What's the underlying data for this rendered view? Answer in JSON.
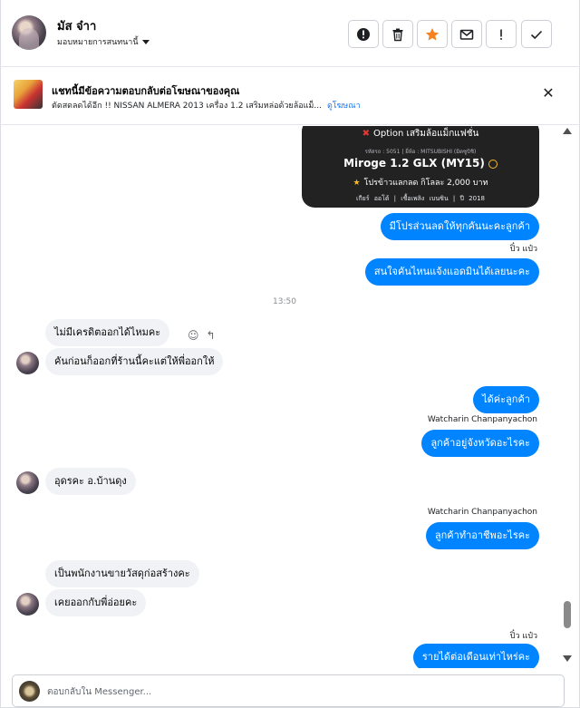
{
  "header": {
    "contact_name": "มัส จ๋าา",
    "assign_label": "มอบหมายการสนทนานี้",
    "tools": [
      {
        "name": "mark-spam",
        "icon": "alert-circle-icon"
      },
      {
        "name": "delete",
        "icon": "trash-icon"
      },
      {
        "name": "star",
        "icon": "star-icon"
      },
      {
        "name": "mark-unread",
        "icon": "envelope-icon"
      },
      {
        "name": "follow-up",
        "icon": "exclamation-icon"
      },
      {
        "name": "done",
        "icon": "check-icon"
      }
    ],
    "accent_star": "#f5821f"
  },
  "ad_banner": {
    "title": "แชทนี้มีข้อความตอบกลับต่อโฆษณาของคุณ",
    "subtitle": "ตัดสดลดได้อีก !! NISSAN ALMERA 2013 เครื่อง 1.2 เสริมหล่อด้วยล้อแม็...",
    "link": "ดูโฆษณา",
    "close_icon": "close-icon"
  },
  "car_card": {
    "option": "Option เสริมล้อแม็กแฟชั่น",
    "meta": "รหัสรถ : 5051 | ยี่ห้อ : MITSUBISHI (มิตซูบิชิ)",
    "model": "Miroge 1.2 GLX (MY15)",
    "promo": "โปรข้าวแลกลด กิโลละ 2,000 บาท",
    "specs": "เกียร์ ออโต้ | เชื้อเพลิง เบนซิน | ปี 2018"
  },
  "messages": {
    "m1": "มีโปรส่วนลดให้ทุกคันนะคะลูกค้า",
    "s1": "ปิ๋ว แป๋ว",
    "m2": "สนใจคันไหนแจ้งแอดมินได้เลยนะคะ",
    "time": "13:50",
    "m3": "ไม่มีเครดิตออกได้ไหมคะ",
    "m4": "คันก่อนก็ออกที่ร้านนี้คะแต่ให้พี่ออกให้",
    "m5": "ได้ค่ะลูกค้า",
    "s2": "Watcharin Chanpanyachon",
    "m6": "ลูกค้าอยู่จังหวัดอะไรคะ",
    "m7": "อุดรคะ อ.บ้านดุง",
    "s3": "Watcharin Chanpanyachon",
    "m8": "ลูกค้าทำอาชีพอะไรคะ",
    "m9": "เป็นพนักงานขายวัสดุก่อสร้างคะ",
    "m10": "เคยออกกับพี่อ่อยคะ",
    "s4": "ปิ๋ว แป๋ว",
    "m11": "รายได้ต่อเดือนเท่าไหร่คะ"
  },
  "colors": {
    "outgoing_bubble": "#0084ff",
    "incoming_bubble": "#f0f2f5"
  },
  "composer": {
    "placeholder": "ตอบกลับใน Messenger..."
  }
}
